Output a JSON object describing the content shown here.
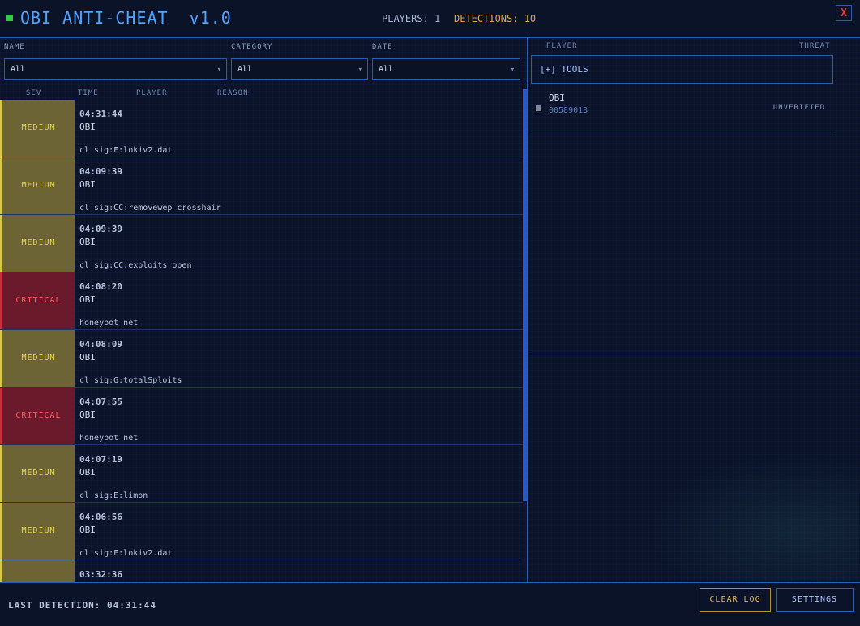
{
  "header": {
    "title": "OBI ANTI-CHEAT  v1.0",
    "players": "PLAYERS: 1",
    "detections": "DETECTIONS: 10",
    "close": "X"
  },
  "filters": [
    {
      "label": "NAME",
      "value": "All"
    },
    {
      "label": "CATEGORY",
      "value": "All"
    },
    {
      "label": "DATE",
      "value": "All"
    }
  ],
  "columns": {
    "sev": "SEV",
    "time": "TIME",
    "player": "PLAYER",
    "reason": "REASON"
  },
  "detections": [
    {
      "severity": "MEDIUM",
      "level": "medium",
      "time": "04:31:44",
      "player": "OBI",
      "reason": "cl sig:F:lokiv2.dat"
    },
    {
      "severity": "MEDIUM",
      "level": "medium",
      "time": "04:09:39",
      "player": "OBI",
      "reason": "cl sig:CC:removewep crosshair"
    },
    {
      "severity": "MEDIUM",
      "level": "medium",
      "time": "04:09:39",
      "player": "OBI",
      "reason": "cl sig:CC:exploits open"
    },
    {
      "severity": "CRITICAL",
      "level": "critical",
      "time": "04:08:20",
      "player": "OBI",
      "reason": "honeypot net"
    },
    {
      "severity": "MEDIUM",
      "level": "medium",
      "time": "04:08:09",
      "player": "OBI",
      "reason": "cl sig:G:totalSploits"
    },
    {
      "severity": "CRITICAL",
      "level": "critical",
      "time": "04:07:55",
      "player": "OBI",
      "reason": "honeypot net"
    },
    {
      "severity": "MEDIUM",
      "level": "medium",
      "time": "04:07:19",
      "player": "OBI",
      "reason": "cl sig:E:limon"
    },
    {
      "severity": "MEDIUM",
      "level": "medium",
      "time": "04:06:56",
      "player": "OBI",
      "reason": "cl sig:F:lokiv2.dat"
    },
    {
      "severity": "",
      "level": "medium",
      "time": "03:32:36",
      "player": "",
      "reason": ""
    }
  ],
  "right_panel": {
    "player_header": "PLAYER",
    "threat_header": "THREAT",
    "tools": "[+] TOOLS",
    "players": [
      {
        "name": "OBI",
        "id": "00589013",
        "status": "UNVERIFIED"
      }
    ]
  },
  "footer": {
    "last_detection": "LAST DETECTION: 04:31:44",
    "clear_log": "CLEAR LOG",
    "settings": "SETTINGS"
  },
  "colors": {
    "accent": "#4fa3ff",
    "medium": "#d6c64a",
    "critical": "#c8303a",
    "online": "#2ecc40"
  }
}
